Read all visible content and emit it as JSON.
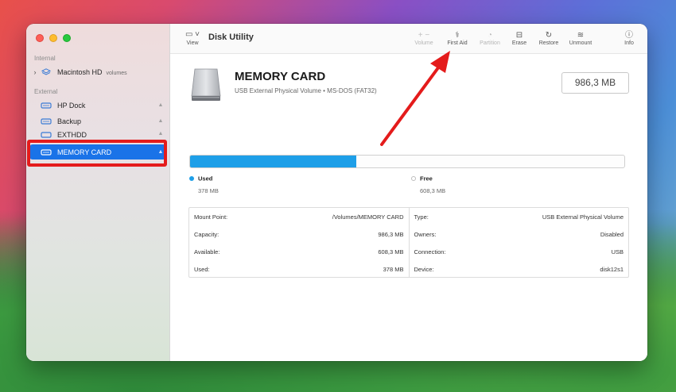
{
  "app": {
    "title": "Disk Utility"
  },
  "toolbar": {
    "view_label": "View",
    "volume_label": "Volume",
    "first_aid_label": "First Aid",
    "partition_label": "Partition",
    "erase_label": "Erase",
    "restore_label": "Restore",
    "unmount_label": "Unmount",
    "info_label": "Info",
    "volume_icons": "+ −"
  },
  "sidebar": {
    "internal_label": "Internal",
    "external_label": "External",
    "internal_items": [
      {
        "label": "Macintosh HD",
        "sub": "volumes"
      }
    ],
    "external_items": [
      {
        "label": "HP Dock"
      },
      {
        "label": "Backup"
      },
      {
        "label": "EXTHDD"
      },
      {
        "label": "MEMORY CARD"
      }
    ]
  },
  "disk": {
    "name": "MEMORY CARD",
    "description": "USB External Physical Volume • MS-DOS (FAT32)",
    "size": "986,3 MB"
  },
  "usage": {
    "used_fraction": 0.383,
    "used_label": "Used",
    "used_value": "378 MB",
    "free_label": "Free",
    "free_value": "608,3 MB",
    "used_color": "#1e9fe8"
  },
  "info": {
    "left": [
      {
        "label": "Mount Point:",
        "value": "/Volumes/MEMORY CARD"
      },
      {
        "label": "Capacity:",
        "value": "986,3 MB"
      },
      {
        "label": "Available:",
        "value": "608,3 MB"
      },
      {
        "label": "Used:",
        "value": "378 MB"
      }
    ],
    "right": [
      {
        "label": "Type:",
        "value": "USB External Physical Volume"
      },
      {
        "label": "Owners:",
        "value": "Disabled"
      },
      {
        "label": "Connection:",
        "value": "USB"
      },
      {
        "label": "Device:",
        "value": "disk12s1"
      }
    ]
  },
  "annotation": {
    "color": "#e41b1b"
  }
}
